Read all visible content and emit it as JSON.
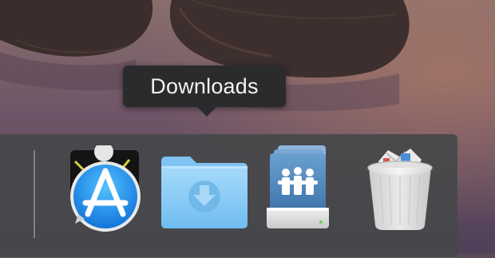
{
  "tooltip": {
    "label": "Downloads"
  },
  "dock": {
    "items": [
      {
        "name": "app-store",
        "icon": "app-store-icon"
      },
      {
        "name": "downloads",
        "icon": "downloads-folder-icon"
      },
      {
        "name": "shared-server",
        "icon": "shared-server-icon"
      },
      {
        "name": "trash",
        "icon": "trash-icon"
      }
    ]
  },
  "colors": {
    "tooltip_bg": "#2b2b2d",
    "dock_bg": "#46484a",
    "folder_blue": "#86c9f5",
    "appstore_blue": "#1d8ff1"
  }
}
